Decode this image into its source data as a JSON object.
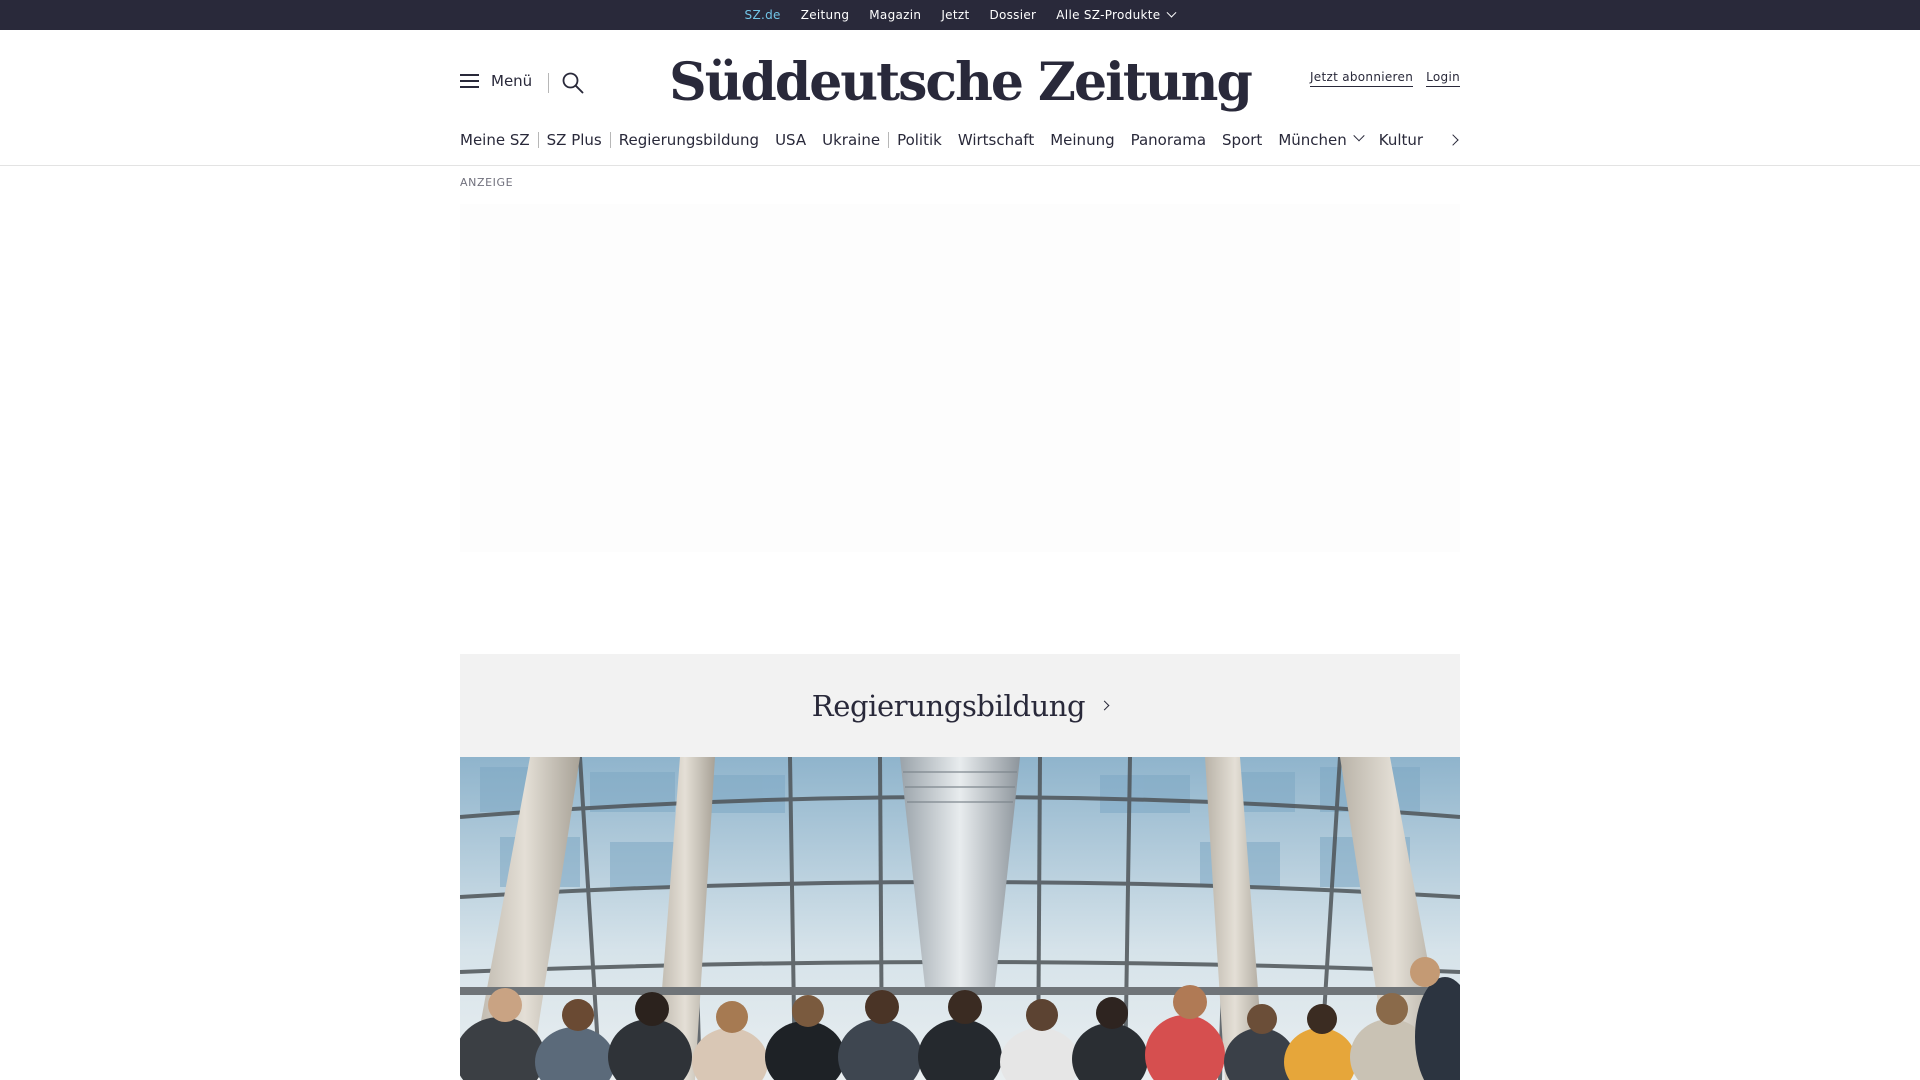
{
  "topbar": {
    "items": [
      {
        "label": "SZ.de",
        "active": true
      },
      {
        "label": "Zeitung",
        "active": false
      },
      {
        "label": "Magazin",
        "active": false
      },
      {
        "label": "Jetzt",
        "active": false
      },
      {
        "label": "Dossier",
        "active": false
      },
      {
        "label": "Alle SZ-Produkte",
        "active": false,
        "dropdown": true
      }
    ]
  },
  "header": {
    "menu_label": "Menü",
    "logo_text": "Süddeutsche Zeitung",
    "subscribe_label": "Jetzt abonnieren",
    "login_label": "Login"
  },
  "nav": {
    "items": [
      {
        "label": "Meine SZ"
      },
      {
        "label": "SZ Plus"
      },
      {
        "label": "Regierungsbildung"
      },
      {
        "label": "USA"
      },
      {
        "label": "Ukraine"
      },
      {
        "label": "Politik"
      },
      {
        "label": "Wirtschaft"
      },
      {
        "label": "Meinung"
      },
      {
        "label": "Panorama"
      },
      {
        "label": "Sport"
      },
      {
        "label": "München"
      },
      {
        "label": "Kultur"
      }
    ]
  },
  "ad": {
    "label": "ANZEIGE"
  },
  "teaser": {
    "title": "Regierungsbildung"
  },
  "colors": {
    "topbar_bg": "#29293a",
    "active_link": "#71c5e8",
    "teaser_bg": "#f2f2f2",
    "text": "#29293a"
  },
  "icons": [
    "hamburger-icon",
    "search-icon",
    "chevron-down-icon",
    "chevron-right-icon"
  ]
}
